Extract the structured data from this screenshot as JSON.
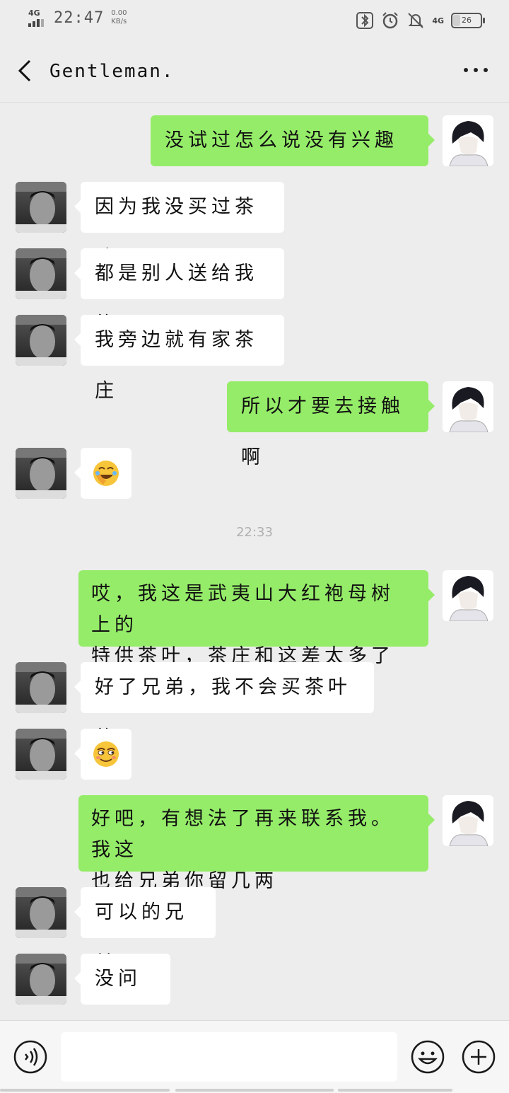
{
  "status_bar": {
    "network_left": "4G",
    "time": "22:47",
    "speed_value": "0.00",
    "speed_unit": "KB/s",
    "network_right": "4G",
    "battery_level": "26"
  },
  "header": {
    "title": "Gentleman.",
    "back_icon": "chevron-left-icon",
    "more_icon": "more-dots-icon"
  },
  "messages": [
    {
      "side": "out",
      "text": "没试过怎么说没有兴趣呢。"
    },
    {
      "side": "in",
      "text": "因为我没买过茶叶"
    },
    {
      "side": "in",
      "text": "都是别人送给我的"
    },
    {
      "side": "in",
      "text": "我旁边就有家茶庄"
    },
    {
      "side": "out",
      "text": "所以才要去接触啊"
    },
    {
      "side": "in",
      "emoji": "facepalm-laughing-emoji"
    },
    {
      "side": "out",
      "line1": "哎，我这是武夷山大红袍母树上的",
      "line2": "特供茶叶，茶庄和这差太多了啊"
    },
    {
      "side": "in",
      "text": "好了兄弟，我不会买茶叶的"
    },
    {
      "side": "in",
      "emoji": "smirk-emoji"
    },
    {
      "side": "out",
      "line1": "好吧，有想法了再来联系我。我这",
      "line2": "也给兄弟你留几两"
    },
    {
      "side": "in",
      "text": "可以的兄弟"
    },
    {
      "side": "in",
      "text": "没问题"
    }
  ],
  "timestamp": "22:33",
  "input_bar": {
    "voice_icon": "voice-icon",
    "emoji_icon": "emoji-icon",
    "plus_icon": "plus-icon"
  },
  "colors": {
    "background": "#ededed",
    "outgoing_bubble": "#95ec69",
    "incoming_bubble": "#ffffff"
  }
}
